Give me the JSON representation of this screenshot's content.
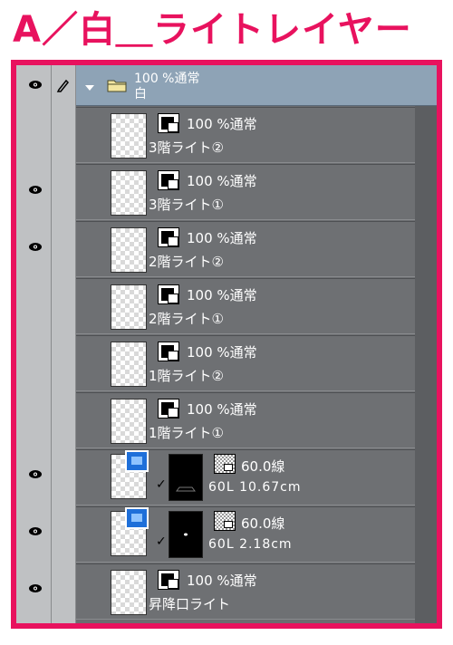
{
  "title": "A／白＿ライトレイヤー",
  "colors": {
    "accent": "#e8125e",
    "panel": "#6e7073",
    "folder": "#8ea3b6"
  },
  "folder": {
    "mode": "100 %通常",
    "name": "白"
  },
  "layers": [
    {
      "mode": "100 %通常",
      "name": "3階ライト②"
    },
    {
      "mode": "100 %通常",
      "name": "3階ライト①"
    },
    {
      "mode": "100 %通常",
      "name": "2階ライト②"
    },
    {
      "mode": "100 %通常",
      "name": "2階ライト①"
    },
    {
      "mode": "100 %通常",
      "name": "1階ライト②"
    },
    {
      "mode": "100 %通常",
      "name": "1階ライト①"
    }
  ],
  "vector_layers": [
    {
      "mode": "60.0線",
      "info": "60L 10.67cm"
    },
    {
      "mode": "60.0線",
      "info": "60L 2.18cm"
    }
  ],
  "last_layer": {
    "mode": "100 %通常",
    "name": "昇降口ライト"
  }
}
